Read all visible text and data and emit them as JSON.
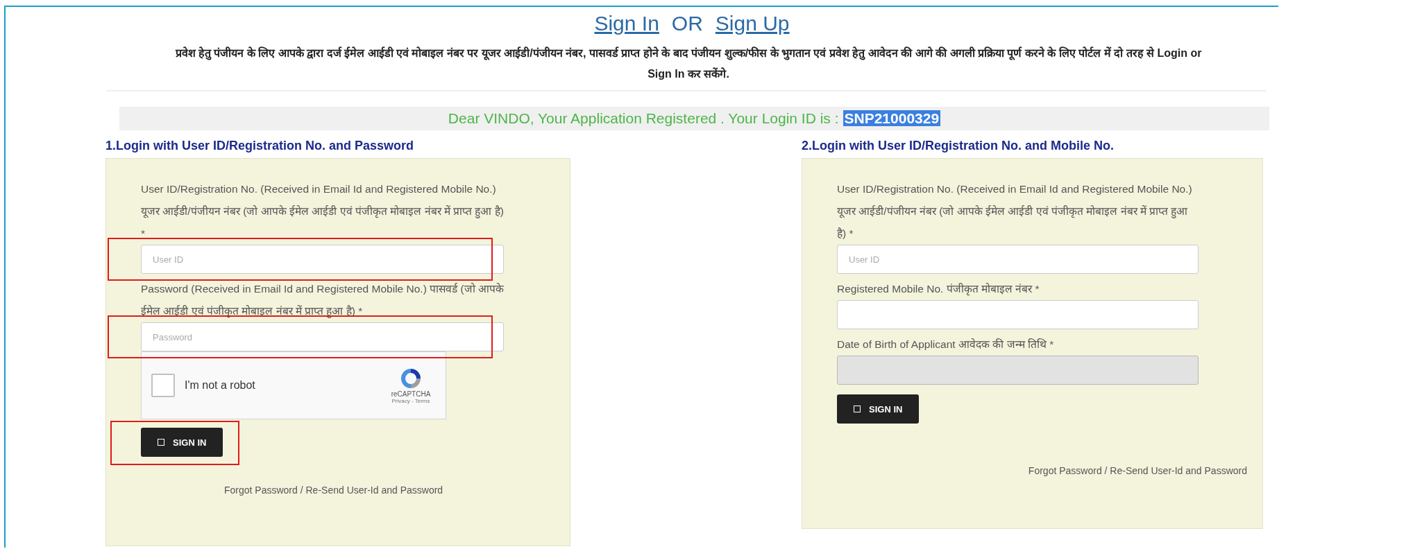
{
  "header": {
    "links": [
      {
        "label": "Sign In"
      },
      {
        "label": "Sign Up"
      }
    ],
    "separator": "OR",
    "notice": "प्रवेश हेतु पंजीयन के लिए आपके द्वारा दर्ज ईमेल आईडी एवं मोबाइल नंबर पर यूजर आईडी/पंजीयन नंबर, पासवर्ड प्राप्त होने के बाद पंजीयन शुल्क/फीस के भुगतान एवं प्रवेश हेतु आवेदन की आगे की अगली प्रक्रिया पूर्ण करने के लिए पोर्टल में दो तरह से Login or Sign In कर सकेंगे."
  },
  "banner": {
    "message": "Dear VINDO, Your Application Registered . Your Login ID is :",
    "login_id": "SNP21000329"
  },
  "forms": [
    {
      "heading": "1.Login with User ID/Registration No. and Password",
      "fields": [
        {
          "label": "User ID/Registration No. (Received in Email Id and Registered Mobile No.) यूजर आईडी/पंजीयन नंबर (जो आपके ईमेल आईडी एवं पंजीकृत मोबाइल नंबर में प्राप्त हुआ है) *",
          "placeholder": "User ID",
          "highlighted": true,
          "disabled": false
        },
        {
          "label": "Password (Received in Email Id and Registered Mobile No.) पासवर्ड (जो आपके ईमेल आईडी एवं पंजीकृत मोबाइल नंबर में प्राप्त हुआ है) *",
          "placeholder": "Password",
          "highlighted": true,
          "disabled": false
        }
      ],
      "captcha": {
        "label": "I'm not a robot",
        "brand": "reCAPTCHA",
        "links": "Privacy - Terms",
        "checked": false
      },
      "button": {
        "label": "SIGN IN",
        "highlighted": true
      },
      "forgot_link": "Forgot Password / Re-Send User-Id and Password"
    },
    {
      "heading": "2.Login with User ID/Registration No. and Mobile No.",
      "fields": [
        {
          "label": "User ID/Registration No. (Received in Email Id and Registered Mobile No.) यूजर आईडी/पंजीयन नंबर (जो आपके ईमेल आईडी एवं पंजीकृत मोबाइल नंबर में प्राप्त हुआ है) *",
          "placeholder": "User ID",
          "highlighted": false,
          "disabled": false
        },
        {
          "label": "Registered Mobile No. पंजीकृत मोबाइल नंबर *",
          "highlighted": false,
          "disabled": false
        },
        {
          "label": "Date of Birth of Applicant आवेदक की जन्म तिथि *",
          "highlighted": false,
          "disabled": true
        }
      ],
      "button": {
        "label": "SIGN IN"
      },
      "forgot_link": "Forgot Password / Re-Send User-Id and Password"
    }
  ]
}
